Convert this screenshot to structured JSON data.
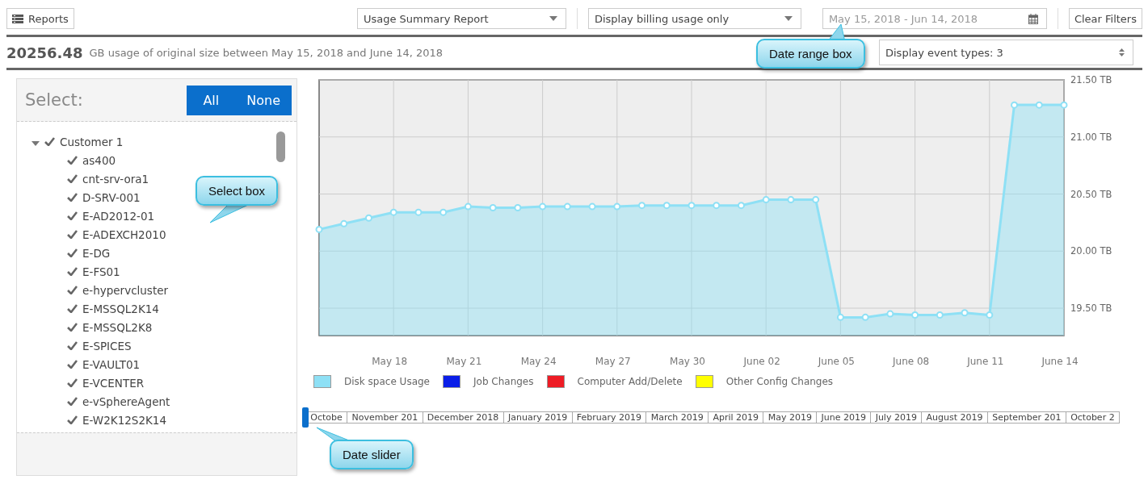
{
  "toolbar": {
    "reports_button": "Reports",
    "report_select": "Usage Summary Report",
    "usage_select": "Display billing usage only",
    "date_range": "May 15, 2018 - Jun 14, 2018",
    "clear_button": "Clear Filters"
  },
  "summary": {
    "total": "20256.48",
    "text": "GB usage of original size between May 15, 2018 and June 14, 2018",
    "event_select": "Display event types: 3"
  },
  "select_panel": {
    "title": "Select:",
    "buttons": [
      "All",
      "None"
    ],
    "tree": [
      {
        "label": "Customer 1",
        "expanded": true,
        "checked": true,
        "children": [
          {
            "label": "as400",
            "checked": true
          },
          {
            "label": "cnt-srv-ora1",
            "checked": true
          },
          {
            "label": "D-SRV-001",
            "checked": true
          },
          {
            "label": "E-AD2012-01",
            "checked": true
          },
          {
            "label": "E-ADEXCH2010",
            "checked": true
          },
          {
            "label": "E-DG",
            "checked": true
          },
          {
            "label": "E-FS01",
            "checked": true
          },
          {
            "label": "e-hypervcluster",
            "checked": true
          },
          {
            "label": "E-MSSQL2K14",
            "checked": true
          },
          {
            "label": "E-MSSQL2K8",
            "checked": true
          },
          {
            "label": "E-SPICES",
            "checked": true
          },
          {
            "label": "E-VAULT01",
            "checked": true
          },
          {
            "label": "E-VCENTER",
            "checked": true
          },
          {
            "label": "e-vSphereAgent",
            "checked": true
          },
          {
            "label": "E-W2K12S2K14",
            "checked": true
          }
        ]
      }
    ]
  },
  "chart": {
    "chart_data": {
      "type": "area",
      "categories": [
        null,
        null,
        null,
        "May 18",
        null,
        null,
        "May 21",
        null,
        null,
        "May 24",
        null,
        null,
        "May 27",
        null,
        null,
        "May 30",
        null,
        null,
        "June 02",
        null,
        null,
        "June 05",
        null,
        null,
        "June 08",
        null,
        null,
        "June 11",
        null,
        null,
        "June 14"
      ],
      "series": [
        {
          "name": "Disk space Usage",
          "color": "#8ee0f5",
          "values": [
            20.19,
            20.24,
            20.29,
            20.34,
            20.34,
            20.34,
            20.39,
            20.38,
            20.38,
            20.39,
            20.39,
            20.39,
            20.39,
            20.4,
            20.4,
            20.4,
            20.4,
            20.4,
            20.45,
            20.45,
            20.45,
            19.42,
            19.42,
            19.45,
            19.44,
            19.44,
            19.46,
            19.44,
            21.28,
            21.28,
            21.28
          ]
        }
      ],
      "ylim": [
        19.26,
        21.5
      ],
      "grid": true,
      "yticks": [
        {
          "value": 19.5,
          "label": "19.50 TB"
        },
        {
          "value": 20,
          "label": "20.00 TB"
        },
        {
          "value": 20.5,
          "label": "20.50 TB"
        },
        {
          "value": 21,
          "label": "21.00 TB"
        },
        {
          "value": 21.5,
          "label": "21.50 TB"
        }
      ]
    },
    "legend": [
      {
        "label": "Job Changes",
        "color": "#0a1ee8"
      },
      {
        "label": "Computer Add/Delete",
        "color": "#ee1c25"
      },
      {
        "label": "Other Config Changes",
        "color": "#ffff00"
      }
    ]
  },
  "date_slider": {
    "level": 0,
    "months": [
      "Octobe",
      "November 201",
      "December 2018",
      "January 2019",
      "February 2019",
      "March 2019",
      "April 2019",
      "May 2019",
      "June 2019",
      "July 2019",
      "August 2019",
      "September 201",
      "October 2"
    ]
  },
  "callouts": [
    {
      "text": "Date range box"
    },
    {
      "text": "Select box"
    },
    {
      "text": "Date slider"
    }
  ]
}
